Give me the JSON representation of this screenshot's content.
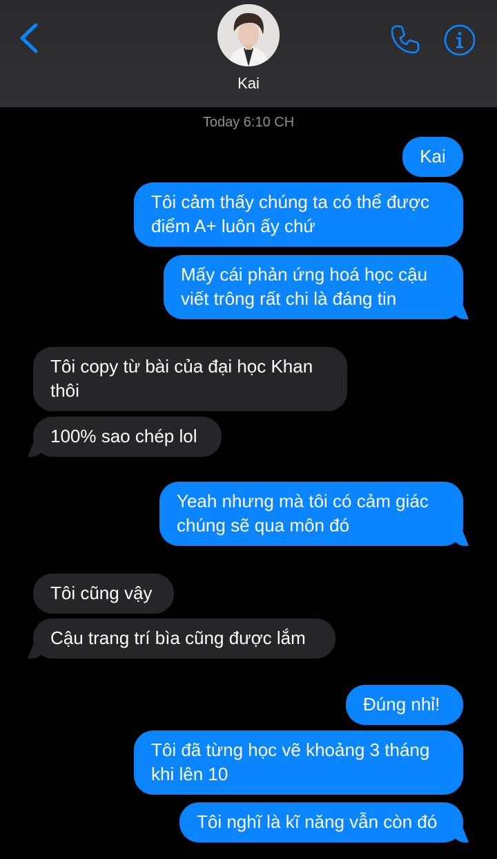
{
  "header": {
    "contact_name": "Kai",
    "icons": [
      "chevron-left-icon",
      "phone-icon",
      "info-icon"
    ],
    "accent_color": "#0a84ff"
  },
  "conversation": {
    "timestamp": "Today 6:10 CH",
    "messages": [
      {
        "from": "me",
        "text": "Kai"
      },
      {
        "from": "me",
        "text": "Tôi cảm thấy chúng ta có thể được điểm A+ luôn ấy chứ"
      },
      {
        "from": "me",
        "text": "Mấy cái phản ứng hoá học cậu viết trông rất chi là đáng tin"
      },
      {
        "from": "them",
        "text": "Tôi copy từ bài của đại học Khan thôi"
      },
      {
        "from": "them",
        "text": "100% sao chép lol"
      },
      {
        "from": "me",
        "text": "Yeah nhưng mà tôi có cảm giác chúng sẽ qua môn đó"
      },
      {
        "from": "them",
        "text": "Tôi cũng vậy"
      },
      {
        "from": "them",
        "text": "Cậu trang trí bìa cũng được lắm"
      },
      {
        "from": "me",
        "text": "Đúng nhỉ!"
      },
      {
        "from": "me",
        "text": "Tôi đã từng học vẽ khoảng 3 tháng khi lên 10"
      },
      {
        "from": "me",
        "text": "Tôi nghĩ là kĩ năng vẫn còn đó"
      }
    ]
  },
  "colors": {
    "sent_bubble": "#0a84ff",
    "received_bubble": "#262628",
    "background": "#000000",
    "timestamp": "#8e8e93"
  }
}
